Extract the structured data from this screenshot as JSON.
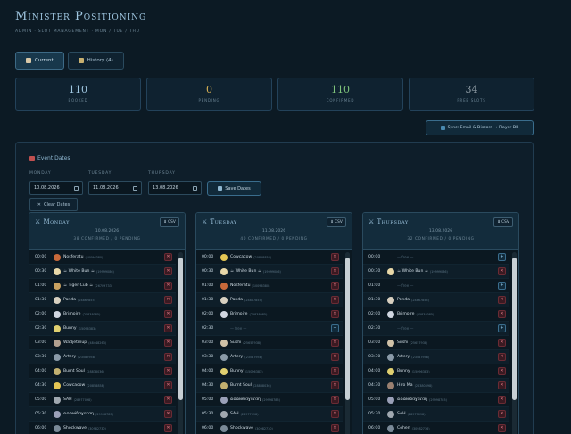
{
  "header": {
    "title": "Minister Positioning",
    "breadcrumb": "Admin · Slot Management · Mon / Tue / Thu"
  },
  "tabs": [
    {
      "label": "Current",
      "active": true
    },
    {
      "label": "History (4)",
      "active": false
    }
  ],
  "stats": [
    {
      "value": "110",
      "label": "Booked",
      "color": "#9fc6e0"
    },
    {
      "value": "0",
      "label": "Pending",
      "color": "#d8b254"
    },
    {
      "value": "110",
      "label": "Confirmed",
      "color": "#7ec27a"
    },
    {
      "value": "34",
      "label": "Free Slots",
      "color": "#8d9aa3"
    }
  ],
  "sync_label": "Sync: Email & Discord → Player DB",
  "event_dates": {
    "title": "Event Dates",
    "fields": [
      {
        "label": "Monday",
        "value": "10.08.2026"
      },
      {
        "label": "Tuesday",
        "value": "11.08.2026"
      },
      {
        "label": "Thursday",
        "value": "13.08.2026"
      }
    ],
    "save_label": "Save Dates",
    "clear_label": "Clear Dates"
  },
  "days": [
    {
      "title": "Monday",
      "date": "10.08.2026",
      "summary": "38 confirmed / 0 pending",
      "csv_label": "⬇ CSV",
      "rows": [
        {
          "time": "00:00",
          "name": "Nosferatu",
          "uid": "(10096380)",
          "free": false,
          "avatar": "#c8693a"
        },
        {
          "time": "00:30",
          "name": "☕ White Bun ☕",
          "uid": "(19999086)",
          "free": false,
          "avatar": "#e8d8a8"
        },
        {
          "time": "01:00",
          "name": "☕ Tiger Cub ☕",
          "uid": "(26709733)",
          "free": false,
          "avatar": "#c9a160"
        },
        {
          "time": "01:30",
          "name": "Panda",
          "uid": "(24867855)",
          "free": false,
          "avatar": "#d8d0c0"
        },
        {
          "time": "02:00",
          "name": "Brimoire",
          "uid": "(25838085)",
          "free": false,
          "avatar": "#d0d6e0"
        },
        {
          "time": "02:30",
          "name": "Bunny",
          "uid": "(15096383)",
          "free": false,
          "avatar": "#e0d070"
        },
        {
          "time": "03:00",
          "name": "Wadjetmup",
          "uid": "(48448263)",
          "free": false,
          "avatar": "#b2a090"
        },
        {
          "time": "03:30",
          "name": "Artery",
          "uid": "(23587958)",
          "free": false,
          "avatar": "#8a9aa8"
        },
        {
          "time": "04:00",
          "name": "Burnt Soul",
          "uid": "(28838036)",
          "free": false,
          "avatar": "#c2b070"
        },
        {
          "time": "04:30",
          "name": "Cowcacow",
          "uid": "(20858858)",
          "free": false,
          "avatar": "#e4c654"
        },
        {
          "time": "05:00",
          "name": "SAH",
          "uid": "(28977098)",
          "free": false,
          "avatar": "#a0a8b0"
        },
        {
          "time": "05:30",
          "name": "ɷɷɷɴɨɓɑɣɑɾɑɳ",
          "uid": "(29998785)",
          "free": false,
          "avatar": "#9aa0b8"
        },
        {
          "time": "06:00",
          "name": "Shockwave",
          "uid": "(30982730)",
          "free": false,
          "avatar": "#7a8a98"
        }
      ]
    },
    {
      "title": "Tuesday",
      "date": "11.08.2026",
      "summary": "40 confirmed / 0 pending",
      "csv_label": "⬇ CSV",
      "rows": [
        {
          "time": "00:00",
          "name": "Cowcacow",
          "uid": "(20858858)",
          "free": false,
          "avatar": "#e4c654"
        },
        {
          "time": "00:30",
          "name": "☕ White Bun ☕",
          "uid": "(19999086)",
          "free": false,
          "avatar": "#e8d8a8"
        },
        {
          "time": "01:00",
          "name": "Nosferatu",
          "uid": "(10096380)",
          "free": false,
          "avatar": "#c8693a"
        },
        {
          "time": "01:30",
          "name": "Panda",
          "uid": "(24867855)",
          "free": false,
          "avatar": "#d8d0c0"
        },
        {
          "time": "02:00",
          "name": "Brimoire",
          "uid": "(25838085)",
          "free": false,
          "avatar": "#d0d6e0"
        },
        {
          "time": "02:30",
          "name": "",
          "uid": "",
          "free": true,
          "avatar": ""
        },
        {
          "time": "03:00",
          "name": "Sushi",
          "uid": "(25657938)",
          "free": false,
          "avatar": "#d0c2a8"
        },
        {
          "time": "03:30",
          "name": "Artery",
          "uid": "(23587958)",
          "free": false,
          "avatar": "#8a9aa8"
        },
        {
          "time": "04:00",
          "name": "Bunny",
          "uid": "(15096383)",
          "free": false,
          "avatar": "#e0d070"
        },
        {
          "time": "04:30",
          "name": "Burnt Soul",
          "uid": "(28838036)",
          "free": false,
          "avatar": "#c2b070"
        },
        {
          "time": "05:00",
          "name": "ɷɷɷɴɨɓɑɣɑɾɑɳ",
          "uid": "(29998785)",
          "free": false,
          "avatar": "#9aa0b8"
        },
        {
          "time": "05:30",
          "name": "SAH",
          "uid": "(28977098)",
          "free": false,
          "avatar": "#a0a8b0"
        },
        {
          "time": "06:00",
          "name": "Shockwave",
          "uid": "(30982730)",
          "free": false,
          "avatar": "#7a8a98"
        }
      ]
    },
    {
      "title": "Thursday",
      "date": "13.08.2026",
      "summary": "32 confirmed / 0 pending",
      "csv_label": "⬇ CSV",
      "rows": [
        {
          "time": "00:00",
          "name": "",
          "uid": "",
          "free": true,
          "avatar": ""
        },
        {
          "time": "00:30",
          "name": "☕ White Bun ☕",
          "uid": "(19999086)",
          "free": false,
          "avatar": "#e8d8a8"
        },
        {
          "time": "01:00",
          "name": "",
          "uid": "",
          "free": true,
          "avatar": ""
        },
        {
          "time": "01:30",
          "name": "Panda",
          "uid": "(24867855)",
          "free": false,
          "avatar": "#d8d0c0"
        },
        {
          "time": "02:00",
          "name": "Brimoire",
          "uid": "(25838085)",
          "free": false,
          "avatar": "#d0d6e0"
        },
        {
          "time": "02:30",
          "name": "",
          "uid": "",
          "free": true,
          "avatar": ""
        },
        {
          "time": "03:00",
          "name": "Sushi",
          "uid": "(25657938)",
          "free": false,
          "avatar": "#d0c2a8"
        },
        {
          "time": "03:30",
          "name": "Artery",
          "uid": "(23587958)",
          "free": false,
          "avatar": "#8a9aa8"
        },
        {
          "time": "04:00",
          "name": "Bunny",
          "uid": "(15096383)",
          "free": false,
          "avatar": "#e0d070"
        },
        {
          "time": "04:30",
          "name": "Hiro Ma",
          "uid": "(26380398)",
          "free": false,
          "avatar": "#9a8070"
        },
        {
          "time": "05:00",
          "name": "ɷɷɷɴɨɓɑɣɑɾɑɳ",
          "uid": "(29998785)",
          "free": false,
          "avatar": "#9aa0b8"
        },
        {
          "time": "05:30",
          "name": "SAH",
          "uid": "(28977098)",
          "free": false,
          "avatar": "#a0a8b0"
        },
        {
          "time": "06:00",
          "name": "Cohen",
          "uid": "(30982736)",
          "free": false,
          "avatar": "#7a8a98"
        }
      ]
    }
  ],
  "free_text": "— free —"
}
